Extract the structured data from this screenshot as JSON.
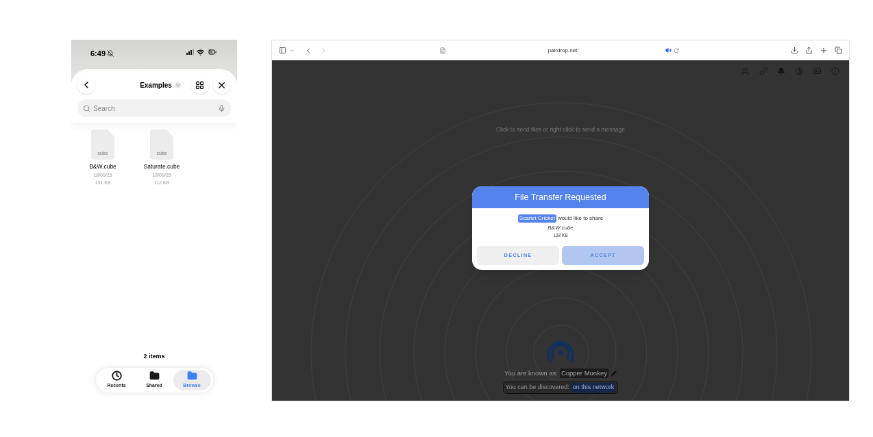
{
  "phone": {
    "status_time": "6:49",
    "title": "Examples",
    "search": {
      "placeholder": "Search"
    },
    "files": [
      {
        "name": "B&W.cube",
        "date": "18/09/25",
        "size": "131 KB",
        "icon_label": "cube"
      },
      {
        "name": "Saturate.cube",
        "date": "18/09/25",
        "size": "112 KB",
        "icon_label": "cube"
      }
    ],
    "item_count": "2 items",
    "tabs": [
      {
        "label": "Recents",
        "kind": "recents",
        "selected": false
      },
      {
        "label": "Shared",
        "kind": "shared",
        "selected": false
      },
      {
        "label": "Browse",
        "kind": "browse",
        "selected": true
      }
    ]
  },
  "browser": {
    "address": "pairdrop.net",
    "audio_playing": true,
    "hint": "Click to send files or right click to send a message",
    "dialog": {
      "title": "File Transfer Requested",
      "sender": "Scarlet Cricket",
      "message": "would like to share",
      "file_name": "B&W.cube",
      "file_size": "128 KB",
      "buttons": [
        {
          "label": "DECLINE",
          "kind": "secondary"
        },
        {
          "label": "ACCEPT",
          "kind": "primary"
        }
      ]
    },
    "known_as_label": "You are known as:",
    "device_name": "Copper Monkey",
    "discover_label": "You can be discovered:",
    "discover_scope": "on this network"
  }
}
